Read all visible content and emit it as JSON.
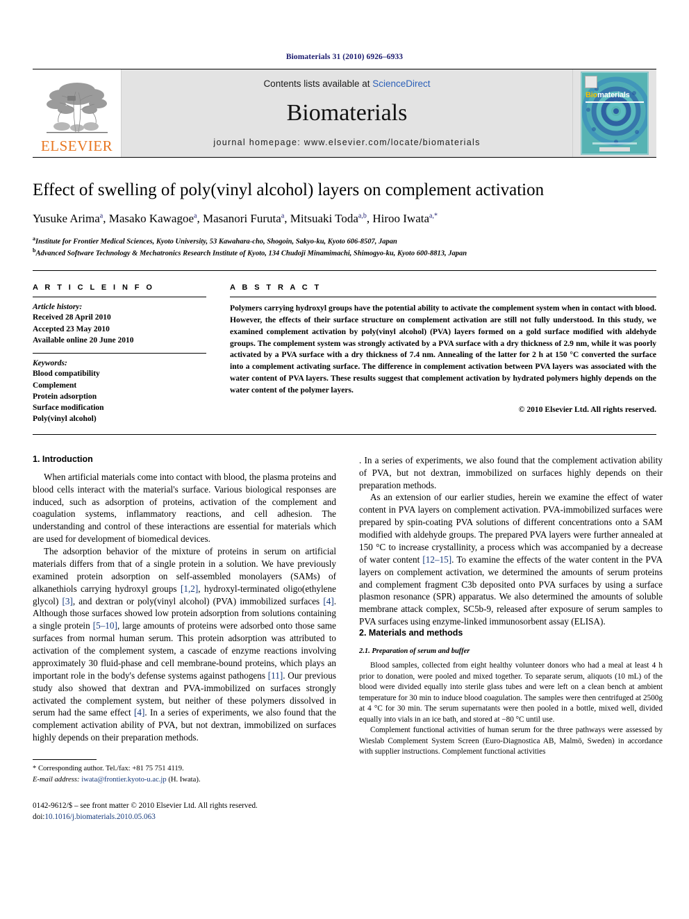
{
  "running_head": "Biomaterials 31 (2010) 6926–6933",
  "masthead": {
    "publisher_logo_text": "ELSEVIER",
    "contents_prefix": "Contents lists available at ",
    "contents_link": "ScienceDirect",
    "journal_name": "Biomaterials",
    "homepage": "journal homepage: www.elsevier.com/locate/biomaterials",
    "cover_title_a": "Bio",
    "cover_title_b": "materials"
  },
  "article": {
    "title": "Effect of swelling of poly(vinyl alcohol) layers on complement activation",
    "authors": [
      {
        "name": "Yusuke Arima",
        "sup": "a"
      },
      {
        "name": "Masako Kawagoe",
        "sup": "a"
      },
      {
        "name": "Masanori Furuta",
        "sup": "a"
      },
      {
        "name": "Mitsuaki Toda",
        "sup": "a,b"
      },
      {
        "name": "Hiroo Iwata",
        "sup": "a,*"
      }
    ],
    "affiliations": [
      {
        "sup": "a",
        "text": "Institute for Frontier Medical Sciences, Kyoto University, 53 Kawahara-cho, Shogoin, Sakyo-ku, Kyoto 606-8507, Japan"
      },
      {
        "sup": "b",
        "text": "Advanced Software Technology & Mechatronics Research Institute of Kyoto, 134 Chudoji Minamimachi, Shimogyo-ku, Kyoto 600-8813, Japan"
      }
    ]
  },
  "info": {
    "heading": "A R T I C L E   I N F O",
    "history_label": "Article history:",
    "history": [
      "Received 28 April 2010",
      "Accepted 23 May 2010",
      "Available online 20 June 2010"
    ],
    "keywords_label": "Keywords:",
    "keywords": [
      "Blood compatibility",
      "Complement",
      "Protein adsorption",
      "Surface modification",
      "Poly(vinyl alcohol)"
    ]
  },
  "abstract": {
    "heading": "A B S T R A C T",
    "text": "Polymers carrying hydroxyl groups have the potential ability to activate the complement system when in contact with blood. However, the effects of their surface structure on complement activation are still not fully understood. In this study, we examined complement activation by poly(vinyl alcohol) (PVA) layers formed on a gold surface modified with aldehyde groups. The complement system was strongly activated by a PVA surface with a dry thickness of 2.9 nm, while it was poorly activated by a PVA surface with a dry thickness of 7.4 nm. Annealing of the latter for 2 h at 150 °C converted the surface into a complement activating surface. The difference in complement activation between PVA layers was associated with the water content of PVA layers. These results suggest that complement activation by hydrated polymers highly depends on the water content of the polymer layers.",
    "copyright": "© 2010 Elsevier Ltd. All rights reserved."
  },
  "sections": {
    "intro_heading": "1. Introduction",
    "intro_p1": "When artificial materials come into contact with blood, the plasma proteins and blood cells interact with the material's surface. Various biological responses are induced, such as adsorption of proteins, activation of the complement and coagulation systems, inflammatory reactions, and cell adhesion. The understanding and control of these interactions are essential for materials which are used for development of biomedical devices.",
    "intro_p2_a": "The adsorption behavior of the mixture of proteins in serum on artificial materials differs from that of a single protein in a solution. We have previously examined protein adsorption on self-assembled monolayers (SAMs) of alkanethiols carrying hydroxyl groups ",
    "ref_1_2": "[1,2]",
    "intro_p2_b": ", hydroxyl-terminated oligo(ethylene glycol) ",
    "ref_3": "[3]",
    "intro_p2_c": ", and dextran or poly(vinyl alcohol) (PVA) immobilized surfaces ",
    "ref_4": "[4]",
    "intro_p2_d": ". Although those surfaces showed low protein adsorption from solutions containing a single protein ",
    "ref_5_10": "[5–10]",
    "intro_p2_e": ", large amounts of proteins were adsorbed onto those same surfaces from normal human serum. This protein adsorption was attributed to activation of the complement system, a cascade of enzyme reactions involving approximately 30 fluid-phase and cell membrane-bound proteins, which plays an important role in the body's defense systems against pathogens ",
    "ref_11": "[11]",
    "intro_p2_f": ". Our previous study also showed that dextran and PVA-immobilized on surfaces strongly activated the complement system, but neither of these polymers dissolved in serum had the same effect ",
    "ref_4b": "[4]",
    "intro_p2_g": ". In a series of experiments, we also found that the complement activation ability of PVA, but not dextran, immobilized on surfaces highly depends on their preparation methods.",
    "intro_p3_a": "As an extension of our earlier studies, herein we examine the effect of water content in PVA layers on complement activation. PVA-immobilized surfaces were prepared by spin-coating PVA solutions of different concentrations onto a SAM modified with aldehyde groups. The prepared PVA layers were further annealed at 150 °C to increase crystallinity, a process which was accompanied by a decrease of water content ",
    "ref_12_15": "[12–15]",
    "intro_p3_b": ". To examine the effects of the water content in the PVA layers on complement activation, we determined the amounts of serum proteins and complement fragment C3b deposited onto PVA surfaces by using a surface plasmon resonance (SPR) apparatus. We also determined the amounts of soluble membrane attack complex, SC5b-9, released after exposure of serum samples to PVA surfaces using enzyme-linked immunosorbent assay (ELISA).",
    "methods_heading": "2. Materials and methods",
    "methods_sub1": "2.1. Preparation of serum and buffer",
    "methods_p1": "Blood samples, collected from eight healthy volunteer donors who had a meal at least 4 h prior to donation, were pooled and mixed together. To separate serum, aliquots (10 mL) of the blood were divided equally into sterile glass tubes and were left on a clean bench at ambient temperature for 30 min to induce blood coagulation. The samples were then centrifuged at 2500g at 4 °C for 30 min. The serum supernatants were then pooled in a bottle, mixed well, divided equally into vials in an ice bath, and stored at −80 °C until use.",
    "methods_p2": "Complement functional activities of human serum for the three pathways were assessed by Wieslab Complement System Screen (Euro-Diagnostica AB, Malmö, Sweden) in accordance with supplier instructions. Complement functional activities"
  },
  "footer": {
    "corresponding": "* Corresponding author. Tel./fax: +81 75 751 4119.",
    "email_label": "E-mail address:",
    "email": "iwata@frontier.kyoto-u.ac.jp",
    "email_suffix": " (H. Iwata).",
    "imprint": "0142-9612/$ – see front matter © 2010 Elsevier Ltd. All rights reserved.",
    "doi_label": "doi:",
    "doi": "10.1016/j.biomaterials.2010.05.063"
  },
  "colors": {
    "link": "#15387a",
    "sciencedirect": "#2b5fb8",
    "elsevier_orange": "#E87722",
    "running_head": "#1a1a6e"
  }
}
